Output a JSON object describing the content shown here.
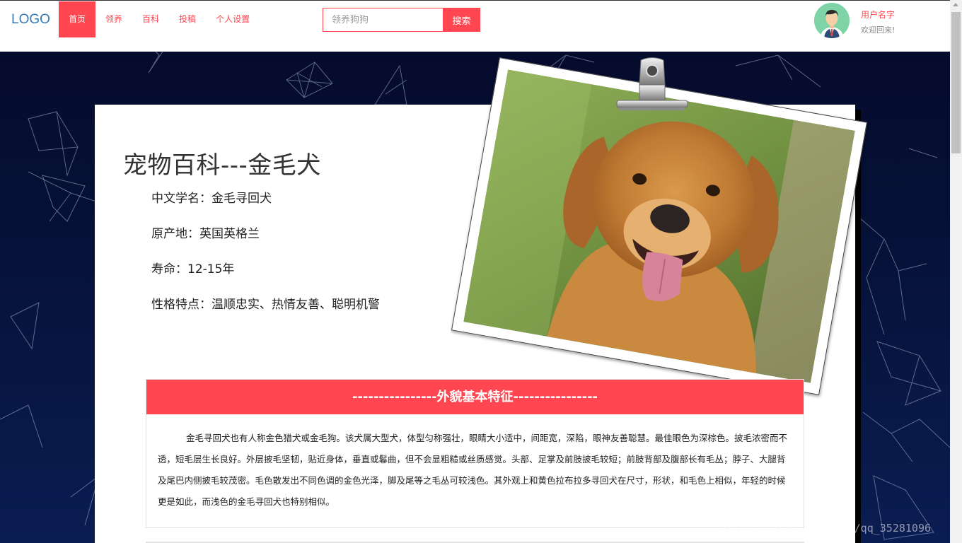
{
  "header": {
    "logo": "LOGO",
    "nav": [
      "首页",
      "领养",
      "百科",
      "投稿",
      "个人设置"
    ],
    "active_nav": 0,
    "search_placeholder": "领养狗狗",
    "search_button": "搜索",
    "user_name": "用户名字",
    "welcome": "欢迎回来!"
  },
  "page": {
    "title": "宠物百科---金毛犬",
    "info": [
      "中文学名：金毛寻回犬",
      "原产地：英国英格兰",
      "寿命：12-15年",
      "性格特点：温顺忠实、热情友善、聪明机警"
    ]
  },
  "feature": {
    "heading": "----------------外貌基本特征----------------",
    "body": "金毛寻回犬也有人称金色猎犬或金毛狗。该犬属大型犬，体型匀称强壮，眼睛大小适中，间距宽，深陷，眼神友善聪慧。最佳眼色为深棕色。披毛浓密而不透，短毛层生长良好。外层披毛坚韧，贴近身体，垂直或鬈曲，但不会显粗糙或丝质感觉。头部、足掌及前肢披毛较短；前肢背部及腹部长有毛丛；脖子、大腿背及尾巴内侧披毛较茂密。毛色散发出不同色调的金色光泽，脚及尾等之毛丛可较浅色。其外观上和黄色拉布拉多寻回犬在尺寸，形状，和毛色上相似，年轻的时候更是如此，而浅色的金毛寻回犬也特别相似。"
  },
  "watermark": "https://blog.csdn.net/qq_35281096",
  "colors": {
    "accent": "#ff4651",
    "background_dark": "#050b2c"
  },
  "icons": [
    "user-avatar-icon",
    "binder-clip-icon"
  ]
}
